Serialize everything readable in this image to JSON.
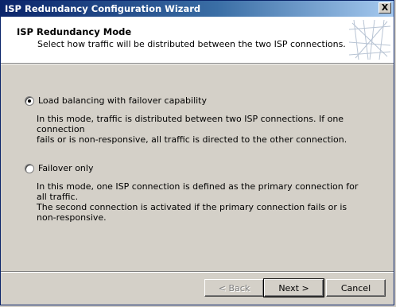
{
  "window": {
    "title": "ISP Redundancy Configuration Wizard",
    "close_label": "X"
  },
  "header": {
    "title": "ISP Redundancy Mode",
    "subtitle": "Select how traffic will be distributed between the two ISP connections."
  },
  "options": [
    {
      "label": "Load balancing with failover capability",
      "selected": true,
      "description_lines": [
        "In this mode, traffic is distributed between two ISP connections. If one connection",
        "fails or is non-responsive, all traffic is directed to the other connection."
      ]
    },
    {
      "label": "Failover only",
      "selected": false,
      "description_lines": [
        "In this mode, one ISP connection is defined as the primary connection for all traffic.",
        "The second connection is activated if the primary connection fails or is",
        "non-responsive."
      ]
    }
  ],
  "buttons": {
    "back": "< Back",
    "next": "Next >",
    "cancel": "Cancel"
  }
}
